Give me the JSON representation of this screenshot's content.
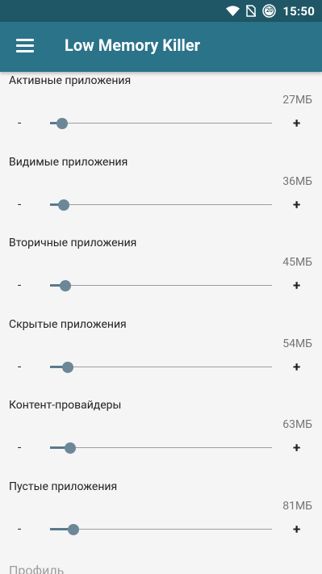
{
  "status_bar": {
    "time": "15:50",
    "battery_level": "20",
    "icons": [
      "wifi-icon",
      "no-sim-icon",
      "battery-icon"
    ]
  },
  "app_bar": {
    "title": "Low Memory Killer",
    "menu_icon": "hamburger-menu-icon"
  },
  "settings": [
    {
      "title": "Активные приложения",
      "value": "27МБ",
      "level": 0.03
    },
    {
      "title": "Видимые приложения",
      "value": "36МБ",
      "level": 0.035
    },
    {
      "title": "Вторичные приложения",
      "value": "45МБ",
      "level": 0.045
    },
    {
      "title": "Скрытые приложения",
      "value": "54МБ",
      "level": 0.055
    },
    {
      "title": "Контент-провайдеры",
      "value": "63МБ",
      "level": 0.065
    },
    {
      "title": "Пустые приложения",
      "value": "81МБ",
      "level": 0.08
    }
  ],
  "controls": {
    "minus_label": "-",
    "plus_label": "+"
  },
  "section": {
    "profile_title": "Профиль"
  },
  "colors": {
    "status_bar": "#1f5766",
    "app_bar": "#2a7389",
    "slider_thumb": "#6c8898"
  }
}
